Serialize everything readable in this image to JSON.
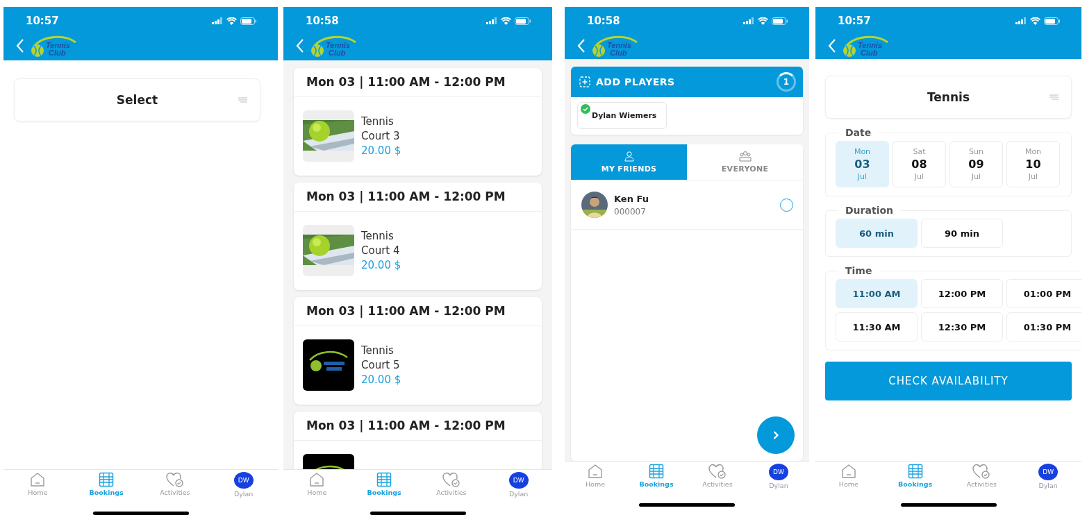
{
  "screens": [
    {
      "kind": "select",
      "time": "10:57",
      "logo": {
        "line1": "Tennis",
        "line2": "Club"
      },
      "select": {
        "label": "Select"
      },
      "tabbar": [
        {
          "kind": "home",
          "label": "Home",
          "selected": false
        },
        {
          "kind": "bookings",
          "label": "Bookings",
          "selected": true
        },
        {
          "kind": "activities",
          "label": "Activities",
          "selected": false
        },
        {
          "kind": "profile",
          "label": "Dylan",
          "initials": "DW",
          "selected": false
        }
      ]
    },
    {
      "kind": "list",
      "time": "10:58",
      "logo": {
        "line1": "Tennis",
        "line2": "Club"
      },
      "slots": [
        {
          "header": "Mon 03 | 11:00 AM - 12:00 PM",
          "sport": "Tennis",
          "court": "Court 3",
          "price": "20.00 $"
        },
        {
          "header": "Mon 03 | 11:00 AM - 12:00 PM",
          "sport": "Tennis",
          "court": "Court 4",
          "price": "20.00 $"
        },
        {
          "header": "Mon 03 | 11:00 AM - 12:00 PM",
          "sport": "Tennis",
          "court": "Court 5",
          "price": "20.00 $"
        },
        {
          "header": "Mon 03 | 11:00 AM - 12:00 PM"
        }
      ],
      "tabbar": [
        {
          "kind": "home",
          "label": "Home",
          "selected": false
        },
        {
          "kind": "bookings",
          "label": "Bookings",
          "selected": true
        },
        {
          "kind": "activities",
          "label": "Activities",
          "selected": false
        },
        {
          "kind": "profile",
          "label": "Dylan",
          "initials": "DW",
          "selected": false
        }
      ]
    },
    {
      "kind": "players",
      "time": "10:58",
      "logo": {
        "line1": "Tennis",
        "line2": "Club"
      },
      "add_players": {
        "title": "ADD PLAYERS",
        "count": "1",
        "chips": [
          {
            "name": "Dylan Wiemers",
            "confirmed": true
          }
        ]
      },
      "tabs": [
        {
          "label": "MY FRIENDS",
          "selected": true
        },
        {
          "label": "EVERYONE",
          "selected": false
        }
      ],
      "friends": [
        {
          "name": "Ken Fu",
          "id": "000007",
          "selected": false
        }
      ],
      "tabbar": [
        {
          "kind": "home",
          "label": "Home",
          "selected": false
        },
        {
          "kind": "bookings",
          "label": "Bookings",
          "selected": true
        },
        {
          "kind": "activities",
          "label": "Activities",
          "selected": false
        },
        {
          "kind": "profile",
          "label": "Dylan",
          "initials": "DW",
          "selected": false
        }
      ]
    },
    {
      "kind": "booking",
      "time": "10:57",
      "logo": {
        "line1": "Tennis",
        "line2": "Club"
      },
      "select": {
        "label": "Tennis"
      },
      "date": {
        "title": "Date",
        "options": [
          {
            "weekday": "Mon",
            "day": "03",
            "month": "Jul",
            "selected": true
          },
          {
            "weekday": "Sat",
            "day": "08",
            "month": "Jul",
            "selected": false
          },
          {
            "weekday": "Sun",
            "day": "09",
            "month": "Jul",
            "selected": false
          },
          {
            "weekday": "Mon",
            "day": "10",
            "month": "Jul",
            "selected": false
          }
        ]
      },
      "duration": {
        "title": "Duration",
        "options": [
          {
            "label": "60 min",
            "selected": true
          },
          {
            "label": "90 min",
            "selected": false
          }
        ]
      },
      "time_slots": {
        "title": "Time",
        "options": [
          {
            "label": "11:00 AM",
            "selected": true
          },
          {
            "label": "12:00 PM",
            "selected": false
          },
          {
            "label": "01:00 PM",
            "selected": false
          },
          {
            "label": "11:30 AM",
            "selected": false
          },
          {
            "label": "12:30 PM",
            "selected": false
          },
          {
            "label": "01:30 PM",
            "selected": false
          }
        ]
      },
      "button": "CHECK AVAILABILITY",
      "tabbar": [
        {
          "kind": "home",
          "label": "Home",
          "selected": false
        },
        {
          "kind": "bookings",
          "label": "Bookings",
          "selected": true
        },
        {
          "kind": "activities",
          "label": "Activities",
          "selected": false
        },
        {
          "kind": "profile",
          "label": "Dylan",
          "initials": "DW",
          "selected": false
        }
      ]
    }
  ]
}
